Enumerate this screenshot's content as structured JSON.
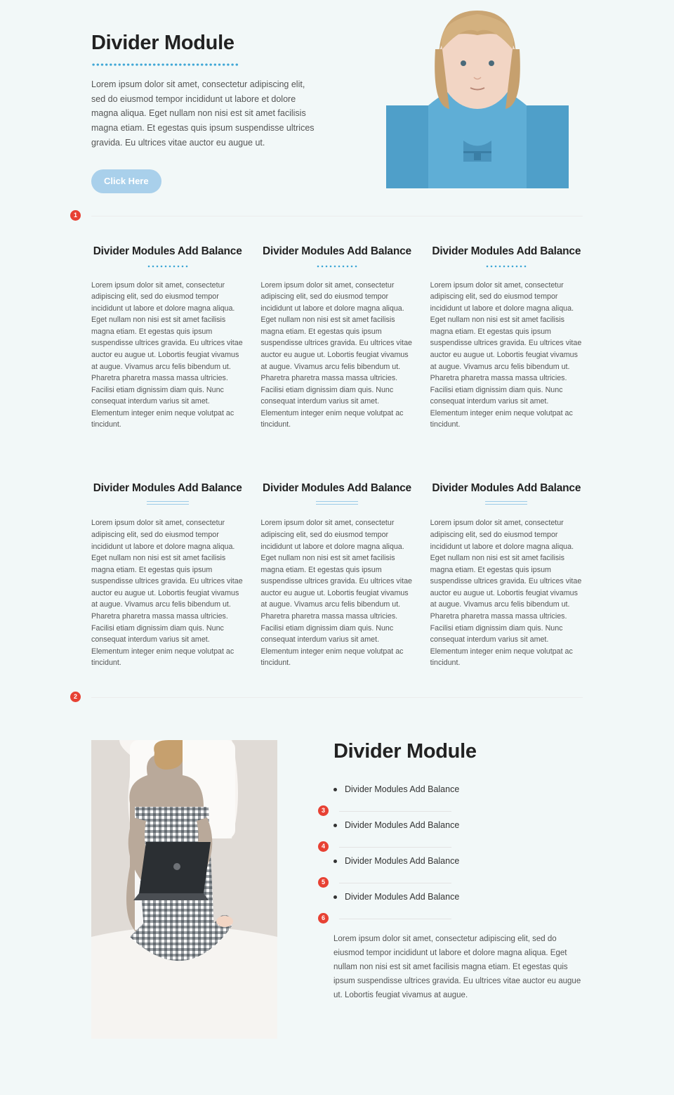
{
  "hero": {
    "title": "Divider Module",
    "paragraph": "Lorem ipsum dolor sit amet, consectetur adipiscing elit, sed do eiusmod tempor incididunt ut labore et dolore magna aliqua. Eget nullam non nisi est sit amet facilisis magna etiam. Et egestas quis ipsum suspendisse ultrices gravida. Eu ultrices vitae auctor eu augue ut.",
    "button": "Click Here"
  },
  "markers": [
    "1",
    "2",
    "3",
    "4",
    "5",
    "6"
  ],
  "features": {
    "title": "Divider Modules Add Balance",
    "body": "Lorem ipsum dolor sit amet, consectetur adipiscing elit, sed do eiusmod tempor incididunt ut labore et dolore magna aliqua. Eget nullam non nisi est sit amet facilisis magna etiam. Et egestas quis ipsum suspendisse ultrices gravida. Eu ultrices vitae auctor eu augue ut. Lobortis feugiat vivamus at augue. Vivamus arcu felis bibendum ut. Pharetra pharetra massa massa ultricies. Facilisi etiam dignissim diam quis. Nunc consequat interdum varius sit amet. Elementum integer enim neque volutpat ac tincidunt."
  },
  "bottom": {
    "title": "Divider Module",
    "bullets": [
      "Divider Modules Add Balance",
      "Divider Modules Add Balance",
      "Divider Modules Add Balance",
      "Divider Modules Add Balance"
    ],
    "paragraph": "Lorem ipsum dolor sit amet, consectetur adipiscing elit, sed do eiusmod tempor incididunt ut labore et dolore magna aliqua. Eget nullam non nisi est sit amet facilisis magna etiam. Et egestas quis ipsum suspendisse ultrices gravida. Eu ultrices vitae auctor eu augue ut. Lobortis feugiat vivamus at augue."
  }
}
